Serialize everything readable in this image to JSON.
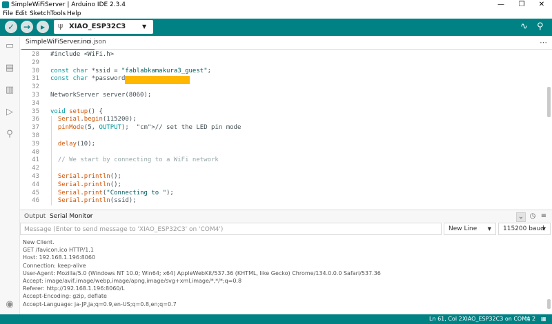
{
  "window": {
    "title": "SimpleWiFiServer | Arduino IDE 2.3.4",
    "minimize": "—",
    "maximize": "❐",
    "close": "✕"
  },
  "menu": [
    "File",
    "Edit",
    "Sketch",
    "Tools",
    "Help"
  ],
  "toolbar": {
    "verify_icon": "✓",
    "upload_icon": "→",
    "debug_icon": "▸",
    "board": "XIAO_ESP32C3",
    "board_caret": "▼",
    "plotter_icon": "∿",
    "monitor_icon": "⚲"
  },
  "sidebar": {
    "sketchbook_icon": "▭",
    "boards_icon": "▤",
    "library_icon": "▥",
    "debug_icon": "▷",
    "search_icon": "⚲",
    "account_icon": "◉"
  },
  "tabs": [
    "SimpleWiFiServer.ino",
    "ci.json"
  ],
  "tabs_more": "⋯",
  "editor": {
    "lines": [
      {
        "n": "28",
        "code": "#include <WiFi.h>"
      },
      {
        "n": "29",
        "code": ""
      },
      {
        "n": "30",
        "code": "const char *ssid = \"fablabkamakura3_guest\";"
      },
      {
        "n": "31",
        "code": "const char *password = "
      },
      {
        "n": "32",
        "code": ""
      },
      {
        "n": "33",
        "code": "NetworkServer server(8060);"
      },
      {
        "n": "34",
        "code": ""
      },
      {
        "n": "35",
        "code": "void setup() {"
      },
      {
        "n": "36",
        "code": "  Serial.begin(115200);"
      },
      {
        "n": "37",
        "code": "  pinMode(5, OUTPUT);  // set the LED pin mode"
      },
      {
        "n": "38",
        "code": ""
      },
      {
        "n": "39",
        "code": "  delay(10);"
      },
      {
        "n": "40",
        "code": ""
      },
      {
        "n": "41",
        "code": "  // We start by connecting to a WiFi network"
      },
      {
        "n": "42",
        "code": ""
      },
      {
        "n": "43",
        "code": "  Serial.println();"
      },
      {
        "n": "44",
        "code": "  Serial.println();"
      },
      {
        "n": "45",
        "code": "  Serial.print(\"Connecting to \");"
      },
      {
        "n": "46",
        "code": "  Serial.println(ssid);"
      }
    ]
  },
  "panel": {
    "tab_output": "Output",
    "tab_serial": "Serial Monitor",
    "tab_close": "✕",
    "collapse_icon": "⌄",
    "timestamp_icon": "◷",
    "clear_icon": "≡",
    "message_placeholder": "Message (Enter to send message to 'XIAO_ESP32C3' on 'COM4')",
    "line_ending": "New Line",
    "baud": "115200 baud",
    "output_lines": [
      "New Client.",
      "GET /favicon.ico HTTP/1.1",
      "Host: 192.168.1.196:8060",
      "Connection: keep-alive",
      "User-Agent: Mozilla/5.0 (Windows NT 10.0; Win64; x64) AppleWebKit/537.36 (KHTML, like Gecko) Chrome/134.0.0.0 Safari/537.36",
      "Accept: image/avif,image/webp,image/apng,image/svg+xml,image/*,*/*;q=0.8",
      "Referer: http://192.168.1.196:8060/L",
      "Accept-Encoding: gzip, deflate",
      "Accept-Language: ja-JP,ja;q=0.9,en-US;q=0.8,en;q=0.7"
    ]
  },
  "status": {
    "position": "Ln 61, Col 2",
    "board_port": "XIAO_ESP32C3 on COM4",
    "notifications": "2"
  },
  "colors": {
    "accent": "#008184",
    "password_mask": "#ffb700"
  }
}
